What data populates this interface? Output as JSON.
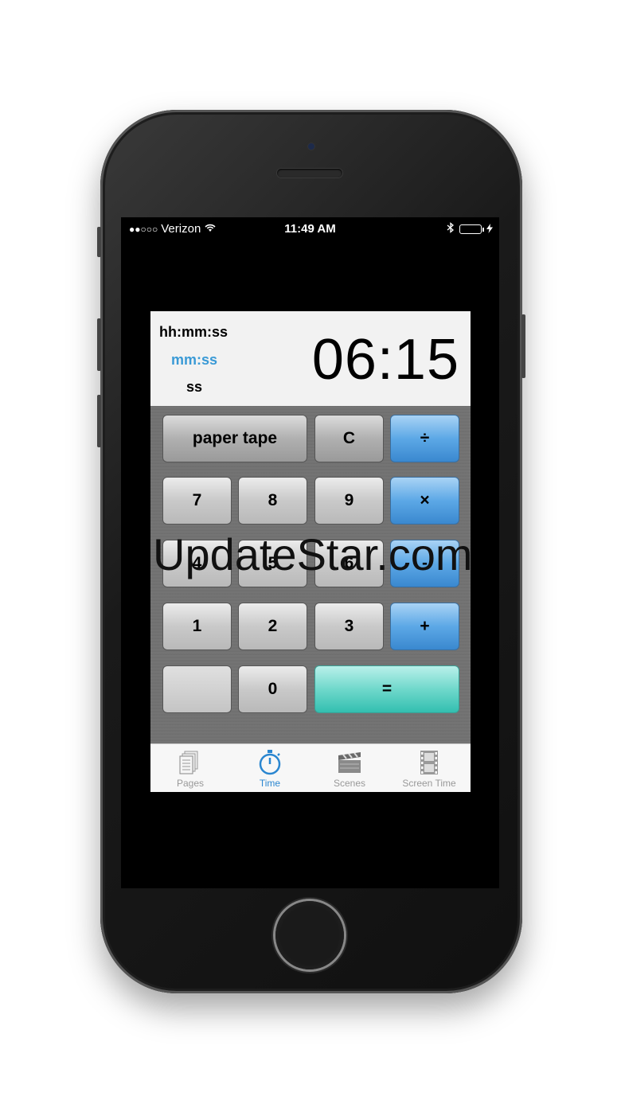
{
  "status_bar": {
    "signal": "●●○○○",
    "carrier": "Verizon",
    "time": "11:49 AM"
  },
  "display": {
    "formats": [
      "hh:mm:ss",
      "mm:ss",
      "ss"
    ],
    "selected_format": "mm:ss",
    "value": "06:15"
  },
  "keys": {
    "paper_tape": "paper tape",
    "clear": "C",
    "divide": "÷",
    "seven": "7",
    "eight": "8",
    "nine": "9",
    "multiply": "×",
    "four": "4",
    "five": "5",
    "six": "6",
    "minus": "-",
    "one": "1",
    "two": "2",
    "three": "3",
    "plus": "+",
    "zero": "0",
    "equals": "="
  },
  "tabs": [
    {
      "label": "Pages",
      "icon": "pages-icon"
    },
    {
      "label": "Time",
      "icon": "stopwatch-icon"
    },
    {
      "label": "Scenes",
      "icon": "clapperboard-icon"
    },
    {
      "label": "Screen Time",
      "icon": "film-strip-icon"
    }
  ],
  "active_tab": "Time",
  "watermark": "UpdateStar.com",
  "colors": {
    "accent": "#2a86d0",
    "operator_key": "#5ca8e6",
    "equals_key": "#6fd8cb",
    "battery": "#4cd964"
  }
}
